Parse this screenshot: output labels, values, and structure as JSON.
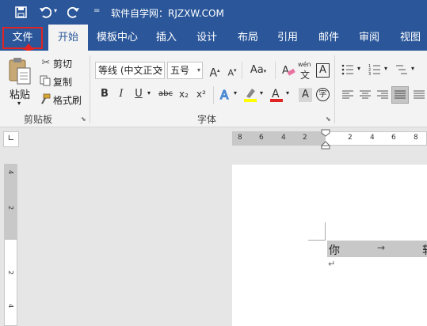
{
  "titlebar": {
    "title": "软件自学网：RJZXW.COM",
    "save_icon": "save-icon",
    "undo_icon": "undo-icon",
    "redo_icon": "redo-icon",
    "customize_icon": "customize-qat-icon"
  },
  "tabs": [
    "文件",
    "开始",
    "模板中心",
    "插入",
    "设计",
    "布局",
    "引用",
    "邮件",
    "审阅",
    "视图"
  ],
  "active_tab": "开始",
  "clipboard": {
    "paste_label": "粘贴",
    "cut_label": "剪切",
    "copy_label": "复制",
    "format_painter_label": "格式刷",
    "group_label": "剪贴板"
  },
  "font": {
    "font_name": "等线 (中文正文",
    "font_size": "五号",
    "bold": "B",
    "italic": "I",
    "underline": "U",
    "strikethrough": "abc",
    "subscript": "x₂",
    "superscript": "x²",
    "phonetic": "wén",
    "group_label": "字体"
  },
  "ruler": {
    "left_numbers": [
      "8",
      "6",
      "4",
      "2"
    ],
    "right_numbers": [
      "2",
      "4",
      "6",
      "8"
    ],
    "vertical_numbers": [
      "4",
      "2",
      "2",
      "4"
    ]
  },
  "document": {
    "line_text": "你",
    "tab_arrow": "→",
    "trailing_char": "软",
    "paragraph_mark": "↵"
  },
  "colors": {
    "accent": "#2b579a",
    "highlight": "#e02424"
  }
}
